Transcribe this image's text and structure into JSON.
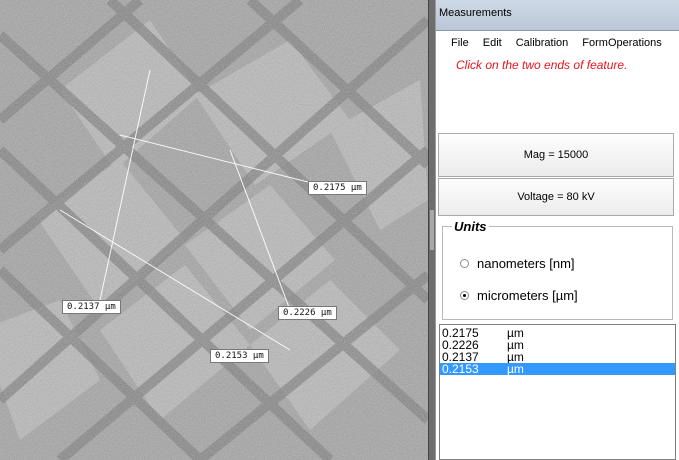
{
  "window": {
    "title": "Measurements"
  },
  "menu": [
    "File",
    "Edit",
    "Calibration",
    "FormOperations"
  ],
  "instruction": "Click on the two ends of feature.",
  "mag_button": "Mag = 15000",
  "voltage_button": "Voltage = 80 kV",
  "units": {
    "legend": "Units",
    "nm_label": "nanometers [nm]",
    "um_label": "micrometers [µm]",
    "selected": "micrometers"
  },
  "image_labels": [
    "0.2175 µm",
    "0.2226 µm",
    "0.2137 µm",
    "0.2153 µm"
  ],
  "measurements": [
    {
      "value": "0.2175",
      "unit": "µm",
      "selected": false
    },
    {
      "value": "0.2226",
      "unit": "µm",
      "selected": false
    },
    {
      "value": "0.2137",
      "unit": "µm",
      "selected": false
    },
    {
      "value": "0.2153",
      "unit": "µm",
      "selected": true
    }
  ],
  "colors": {
    "instruction": "#e8141e",
    "selection": "#3399ff"
  }
}
